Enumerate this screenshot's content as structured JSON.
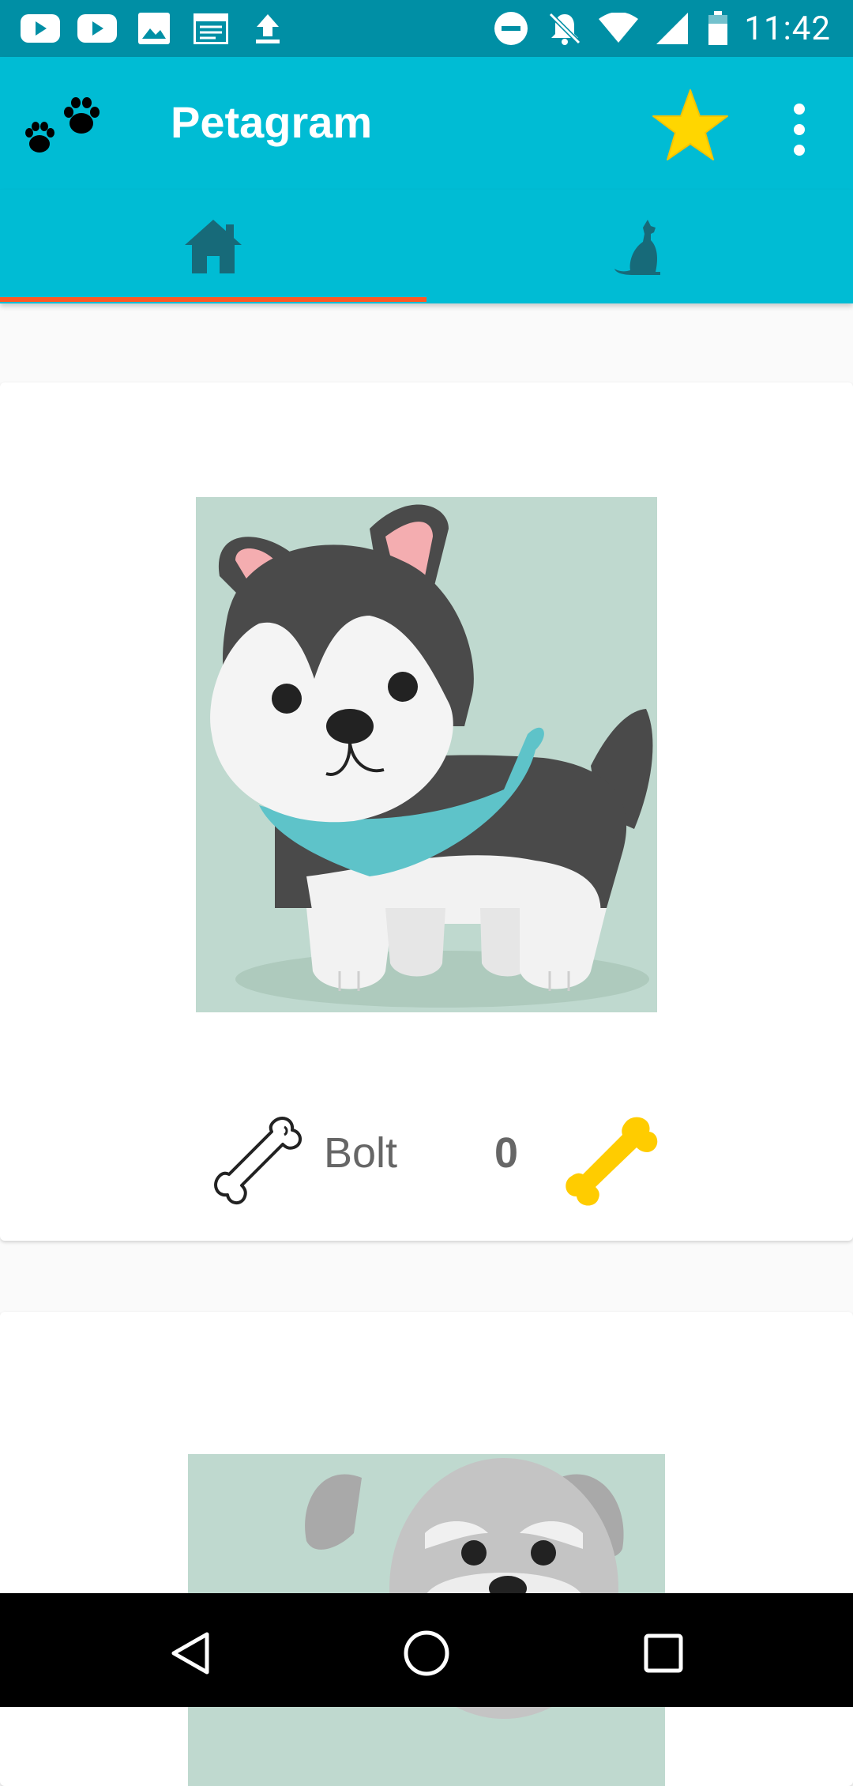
{
  "status_bar": {
    "time": "11:42",
    "left_icons": [
      "youtube-icon",
      "youtube-icon",
      "image-icon",
      "calendar-icon",
      "upload-icon"
    ],
    "right_icons": [
      "dnd-icon",
      "notifications-off-icon",
      "wifi-icon",
      "signal-icon",
      "battery-icon"
    ]
  },
  "app_bar": {
    "title": "Petagram",
    "logo_icon": "paw-prints-icon",
    "action_icon": "star-icon",
    "overflow_icon": "more-vert-icon",
    "colors": {
      "primary": "#00bcd4",
      "primary_dark": "#008fa5",
      "accent": "#ff5722",
      "star": "#ffd600"
    }
  },
  "tabs": [
    {
      "icon": "home-icon",
      "selected": true
    },
    {
      "icon": "pet-profile-icon",
      "selected": false
    }
  ],
  "pets": [
    {
      "name": "Bolt",
      "likes": "0",
      "image": "husky-dog-illustration"
    },
    {
      "name": "",
      "likes": "",
      "image": "schnauzer-dog-illustration"
    }
  ],
  "navigation": [
    "back-icon",
    "home-circle-icon",
    "recents-icon"
  ]
}
